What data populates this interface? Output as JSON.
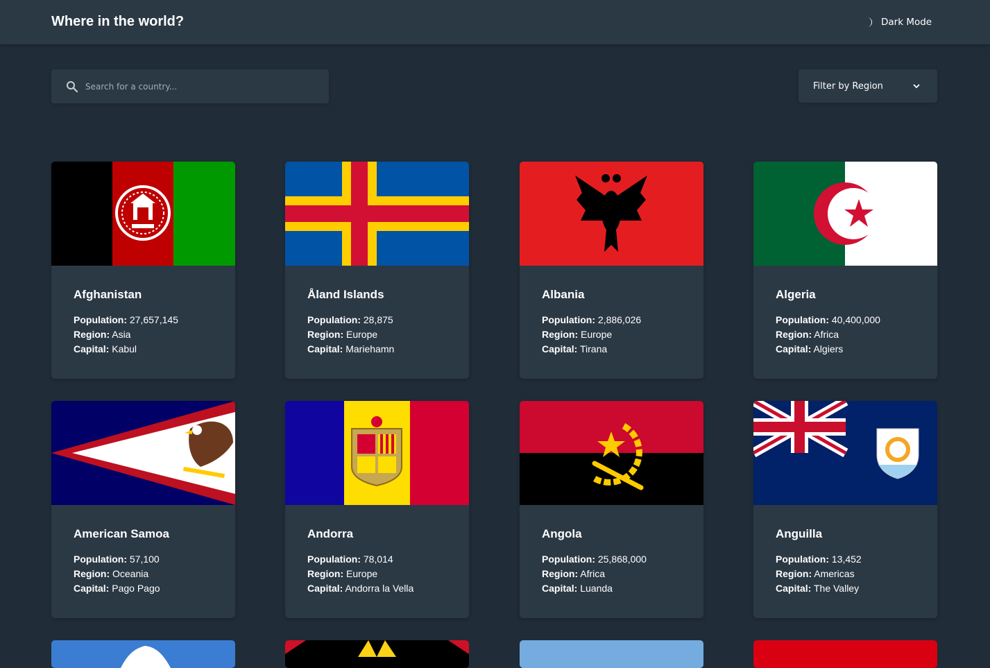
{
  "header": {
    "title": "Where in the world?",
    "mode_label": "Dark Mode"
  },
  "search": {
    "placeholder": "Search for a country..."
  },
  "filter": {
    "label": "Filter by Region"
  },
  "labels": {
    "population": "Population:",
    "region": "Region:",
    "capital": "Capital:"
  },
  "countries": [
    {
      "name": "Afghanistan",
      "population": "27,657,145",
      "region": "Asia",
      "capital": "Kabul"
    },
    {
      "name": "Åland Islands",
      "population": "28,875",
      "region": "Europe",
      "capital": "Mariehamn"
    },
    {
      "name": "Albania",
      "population": "2,886,026",
      "region": "Europe",
      "capital": "Tirana"
    },
    {
      "name": "Algeria",
      "population": "40,400,000",
      "region": "Africa",
      "capital": "Algiers"
    },
    {
      "name": "American Samoa",
      "population": "57,100",
      "region": "Oceania",
      "capital": "Pago Pago"
    },
    {
      "name": "Andorra",
      "population": "78,014",
      "region": "Europe",
      "capital": "Andorra la Vella"
    },
    {
      "name": "Angola",
      "population": "25,868,000",
      "region": "Africa",
      "capital": "Luanda"
    },
    {
      "name": "Anguilla",
      "population": "13,452",
      "region": "Americas",
      "capital": "The Valley"
    }
  ],
  "colors": {
    "background": "#202c37",
    "element": "#2b3945",
    "text": "#ffffff"
  }
}
